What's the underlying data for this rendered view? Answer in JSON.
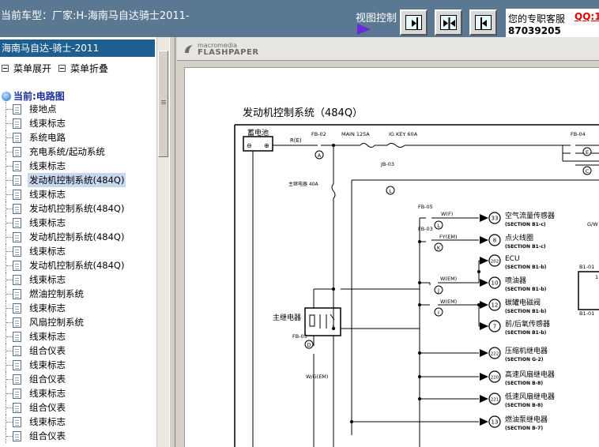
{
  "topbar": {
    "car_title": "当前车型：厂家:H-海南马自达骑士2011-",
    "view_control_label": "视图控制",
    "buttons": [
      {
        "name": "view-next-button"
      },
      {
        "name": "view-fit-button"
      },
      {
        "name": "view-prev-button"
      }
    ],
    "service": {
      "label": "您的专职客服",
      "qq": "QQ:1",
      "number": "87039205"
    }
  },
  "sidebar": {
    "header": "海南马自达-骑士-2011",
    "expand_label": "菜单展开",
    "collapse_label": "菜单折叠",
    "root_label": "当前:电路图",
    "items": [
      {
        "label": "接地点"
      },
      {
        "label": "线束标志"
      },
      {
        "label": "系统电路"
      },
      {
        "label": "充电系统/起动系统"
      },
      {
        "label": "线束标志"
      },
      {
        "label": "发动机控制系统(484Q)",
        "selected": true
      },
      {
        "label": "线束标志"
      },
      {
        "label": "发动机控制系统(484Q)"
      },
      {
        "label": "线束标志"
      },
      {
        "label": "发动机控制系统(484Q)"
      },
      {
        "label": "线束标志"
      },
      {
        "label": "发动机控制系统(484Q)"
      },
      {
        "label": "线束标志"
      },
      {
        "label": "燃油控制系统"
      },
      {
        "label": "线束标志"
      },
      {
        "label": "风扇控制系统"
      },
      {
        "label": "线束标志"
      },
      {
        "label": "组合仪表"
      },
      {
        "label": "线束标志"
      },
      {
        "label": "组合仪表"
      },
      {
        "label": "线束标志"
      },
      {
        "label": "组合仪表"
      },
      {
        "label": "线束标志"
      },
      {
        "label": "组合仪表"
      }
    ]
  },
  "viewer": {
    "logo_top": "macromedia",
    "logo_bottom": "FLASHPAPER"
  },
  "diagram": {
    "title": "发动机控制系统（484Q）",
    "battery_label": "蓄电池",
    "main_relay_label": "主继电器",
    "main_fuse_label": "主继电器 40A",
    "labels": {
      "fb02": "FB-02",
      "main125": "MAIN 125A",
      "igkey": "IG KEY 60A",
      "fb04": "FB-04",
      "re": "R(E)",
      "jb03": "JB-03",
      "fb05": "FB-05",
      "fb03a": "FB-03",
      "fb03b": "FB-03",
      "wf": "W(F)",
      "fyem": "FY(EM)",
      "wem1": "W(EM)",
      "wem2": "W(EM)",
      "wgem": "W/G(EM)",
      "gw": "G/W",
      "b101a": "B1-01",
      "b101b": "B1-01",
      "one": "1"
    },
    "circles": {
      "A": "A",
      "E": "E",
      "C": "C",
      "L1": "L",
      "L2": "L",
      "K": "K",
      "J": "J",
      "I": "I",
      "D": "D"
    },
    "components": [
      {
        "num": "33",
        "name": "空气流量传感器",
        "section": "(SECTION B1-c)"
      },
      {
        "num": "8",
        "name": "点火线圈",
        "section": "(SECTION B1-c)"
      },
      {
        "num": "202",
        "name": "ECU",
        "section": "(SECTION B1-b)"
      },
      {
        "num": "10",
        "name": "喷油器",
        "section": "(SECTION B1-b)"
      },
      {
        "num": "12",
        "name": "碳罐电磁阀",
        "section": "(SECTION B1-b)"
      },
      {
        "num": "7",
        "name": "前/后氧传感器",
        "section": "(SECTION B1-b)"
      },
      {
        "num": "222",
        "name": "压缩机继电器",
        "section": "(SECTION G-2)"
      },
      {
        "num": "220",
        "name": "高速风扇继电器",
        "section": "(SECTION B-8)"
      },
      {
        "num": "221",
        "name": "低速风扇继电器",
        "section": "(SECTION B-8)"
      },
      {
        "num": "13",
        "name": "燃油泵继电器",
        "section": "(SECTION B-7)"
      }
    ]
  }
}
